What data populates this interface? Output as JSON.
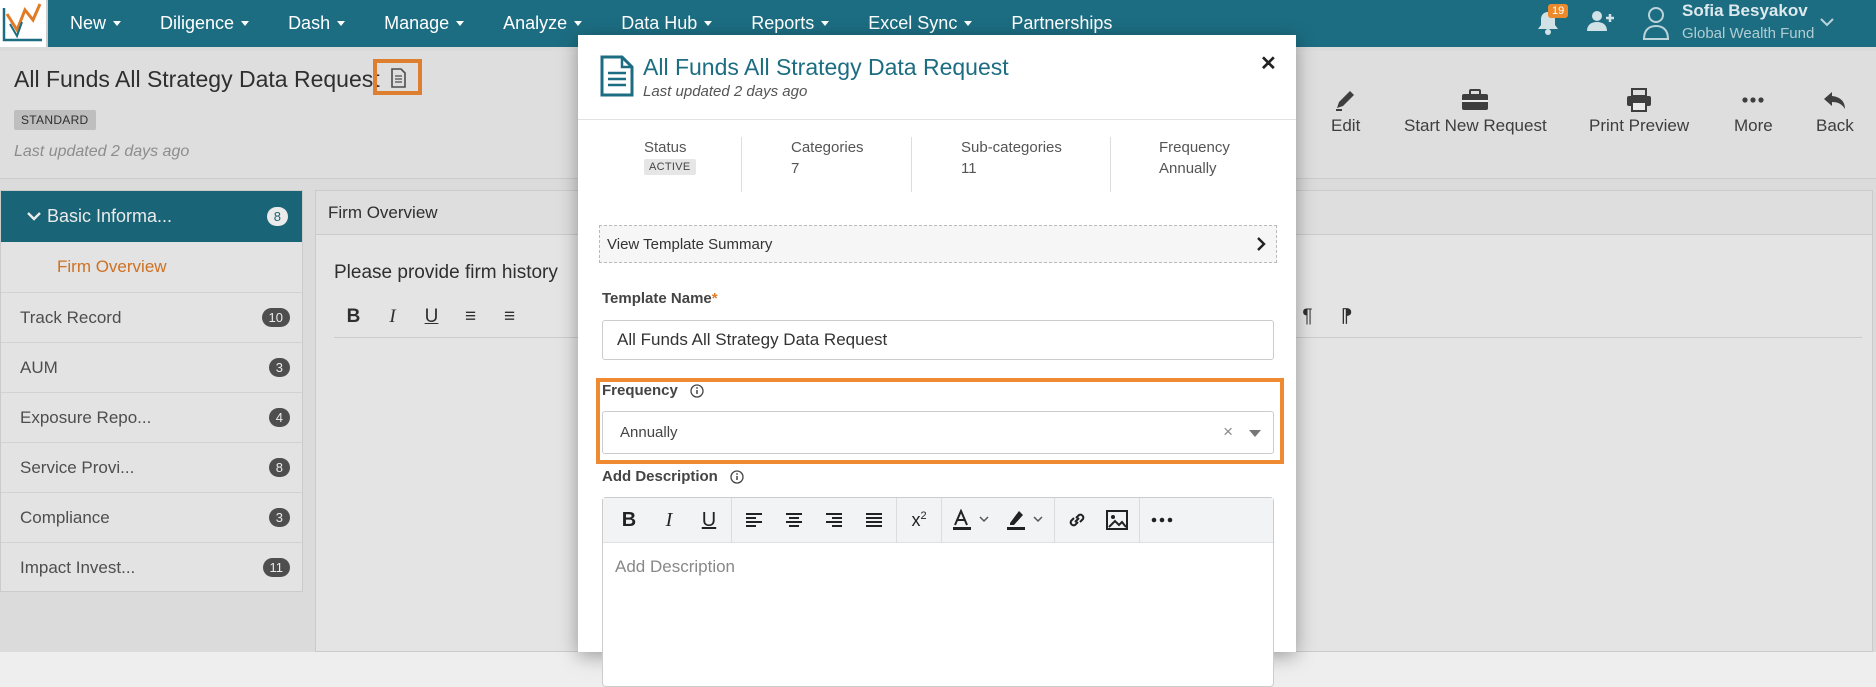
{
  "nav": {
    "items": [
      {
        "label": "New",
        "dropdown": true
      },
      {
        "label": "Diligence",
        "dropdown": true
      },
      {
        "label": "Dash",
        "dropdown": true
      },
      {
        "label": "Manage",
        "dropdown": true
      },
      {
        "label": "Analyze",
        "dropdown": true
      },
      {
        "label": "Data Hub",
        "dropdown": true
      },
      {
        "label": "Reports",
        "dropdown": true
      },
      {
        "label": "Excel Sync",
        "dropdown": true
      },
      {
        "label": "Partnerships",
        "dropdown": false
      }
    ],
    "notifications_count": "19",
    "user_name": "Sofia Besyakov",
    "user_org": "Global Wealth Fund",
    "colors": {
      "nav_bg": "#1c6d82",
      "accent": "#f08a32",
      "badge": "#ec8a2b"
    }
  },
  "page": {
    "title": "All Funds All Strategy Data Request",
    "tag": "STANDARD",
    "last_updated": "Last updated 2 days ago"
  },
  "toolbar": {
    "edit": "Edit",
    "start_new": "Start New Request",
    "print_preview": "Print Preview",
    "more": "More",
    "back": "Back"
  },
  "sidebar": {
    "active": {
      "label": "Basic Informa...",
      "count": "8"
    },
    "sub_active": "Firm Overview",
    "items": [
      {
        "label": "Track Record",
        "count": "10"
      },
      {
        "label": "AUM",
        "count": "3"
      },
      {
        "label": "Exposure Repo...",
        "count": "4"
      },
      {
        "label": "Service Provi...",
        "count": "8"
      },
      {
        "label": "Compliance",
        "count": "3"
      },
      {
        "label": "Impact Invest...",
        "count": "11"
      }
    ]
  },
  "main": {
    "panel_title": "Firm Overview",
    "question": "Please provide firm history"
  },
  "modal": {
    "title": "All Funds All Strategy Data Request",
    "subtitle": "Last updated 2 days ago",
    "stats": {
      "status_label": "Status",
      "status_value": "ACTIVE",
      "categories_label": "Categories",
      "categories_value": "7",
      "subcat_label": "Sub-categories",
      "subcat_value": "11",
      "frequency_label": "Frequency",
      "frequency_value": "Annually"
    },
    "view_summary": "View Template Summary",
    "template_name_label": "Template Name",
    "template_name_required": "*",
    "template_name_value": "All Funds All Strategy Data Request",
    "frequency_label": "Frequency",
    "frequency_value": "Annually",
    "description_label": "Add Description",
    "description_placeholder": "Add Description"
  }
}
